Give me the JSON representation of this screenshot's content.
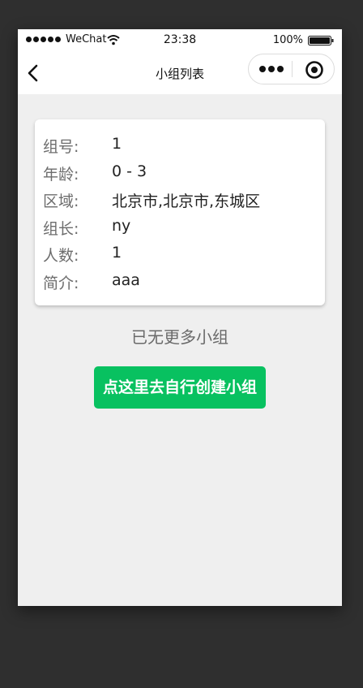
{
  "status_bar": {
    "carrier": "WeChat",
    "time": "23:38",
    "battery": "100%"
  },
  "nav": {
    "title": "小组列表"
  },
  "group": {
    "fields": [
      {
        "label": "组号:",
        "value": "1"
      },
      {
        "label": "年龄:",
        "value": "0 - 3"
      },
      {
        "label": "区域:",
        "value": "北京市,北京市,东城区"
      },
      {
        "label": "组长:",
        "value": "ny"
      },
      {
        "label": "人数:",
        "value": "1"
      },
      {
        "label": "简介:",
        "value": "aaa"
      }
    ]
  },
  "list_end_text": "已无更多小组",
  "create_button_label": "点这里去自行创建小组",
  "colors": {
    "primary_green": "#08c160",
    "background": "#efefef"
  },
  "icons": [
    "back-arrow-icon",
    "more-dots-icon",
    "target-icon",
    "wifi-icon",
    "battery-icon",
    "signal-dots-icon"
  ]
}
